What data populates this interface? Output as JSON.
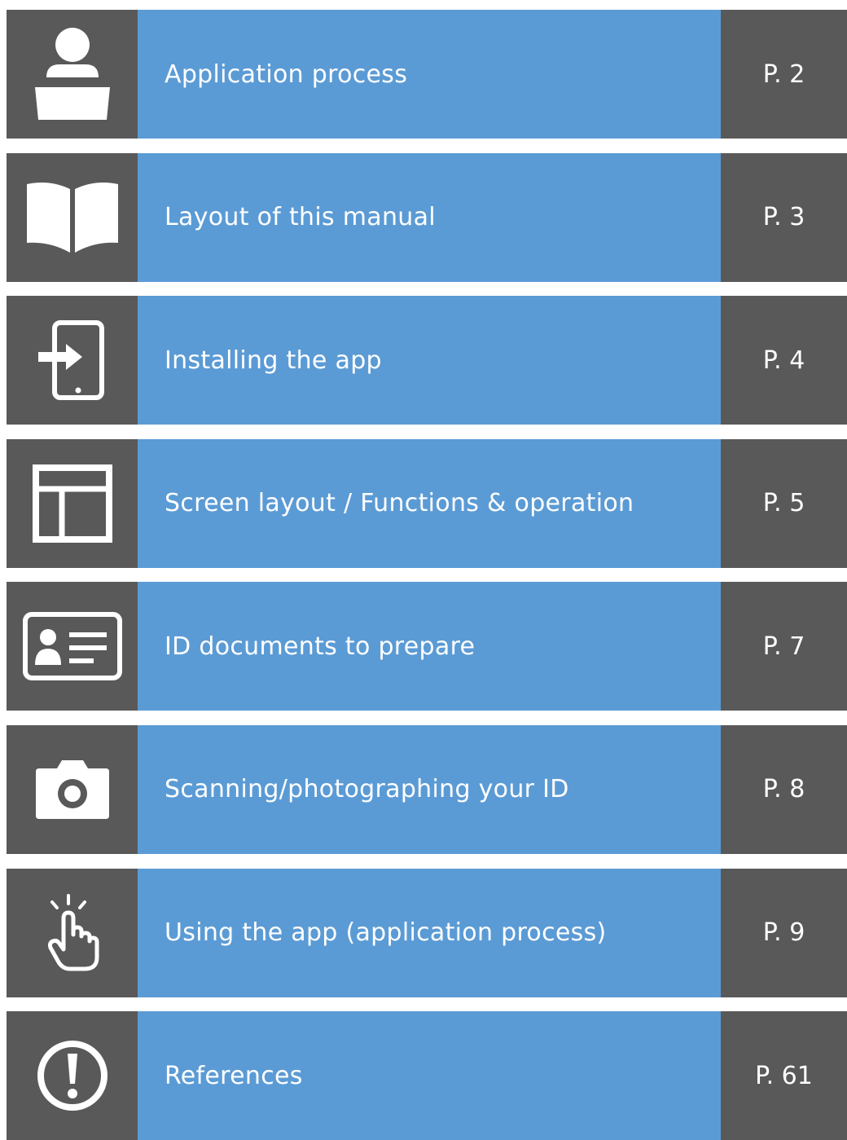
{
  "toc": {
    "items": [
      {
        "icon": "person-at-desk-icon",
        "title": "Application process",
        "page": "P. 2"
      },
      {
        "icon": "open-book-icon",
        "title": "Layout of this manual",
        "page": "P. 3"
      },
      {
        "icon": "phone-install-icon",
        "title": "Installing the app",
        "page": "P. 4"
      },
      {
        "icon": "screen-layout-icon",
        "title": "Screen layout / Functions & operation",
        "page": "P. 5"
      },
      {
        "icon": "id-card-icon",
        "title": "ID documents to prepare",
        "page": "P. 7"
      },
      {
        "icon": "camera-icon",
        "title": "Scanning/photographing your ID",
        "page": "P. 8"
      },
      {
        "icon": "tap-hand-icon",
        "title": "Using the app (application process)",
        "page": "P. 9"
      },
      {
        "icon": "exclamation-circle-icon",
        "title": "References",
        "page": "P. 61"
      }
    ]
  },
  "colors": {
    "icon_bg": "#595959",
    "title_bg": "#5b9bd5",
    "page_bg": "#595959",
    "text": "#ffffff"
  }
}
